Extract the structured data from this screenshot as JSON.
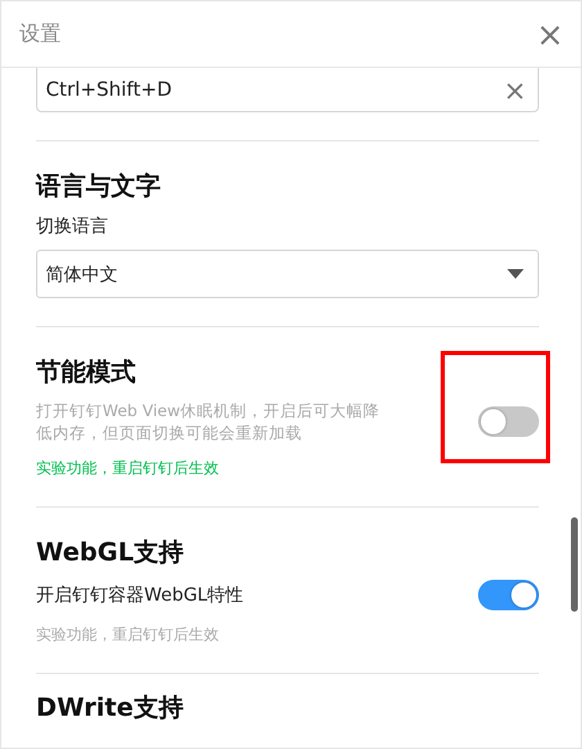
{
  "window": {
    "title": "设置",
    "close": "×"
  },
  "sections": [
    {
      "kind": "shortcut",
      "value": "Ctrl+Shift+D",
      "clear": "×"
    },
    {
      "kind": "select",
      "heading": "语言与文字",
      "label": "切换语言",
      "value": "简体中文"
    },
    {
      "kind": "toggle",
      "heading": "节能模式",
      "description": "打开钉钉Web View休眠机制，开启后可大幅降低内存，但页面切换可能会重新加载",
      "note": "实验功能，重启钉钉后生效",
      "note_highlight": true,
      "on": false,
      "highlighted": true
    },
    {
      "kind": "toggle",
      "heading": "WebGL支持",
      "label": "开启钉钉容器WebGL特性",
      "note": "实验功能，重启钉钉后生效",
      "note_highlight": false,
      "on": true,
      "highlighted": false
    },
    {
      "kind": "heading",
      "heading": "DWrite支持"
    }
  ]
}
